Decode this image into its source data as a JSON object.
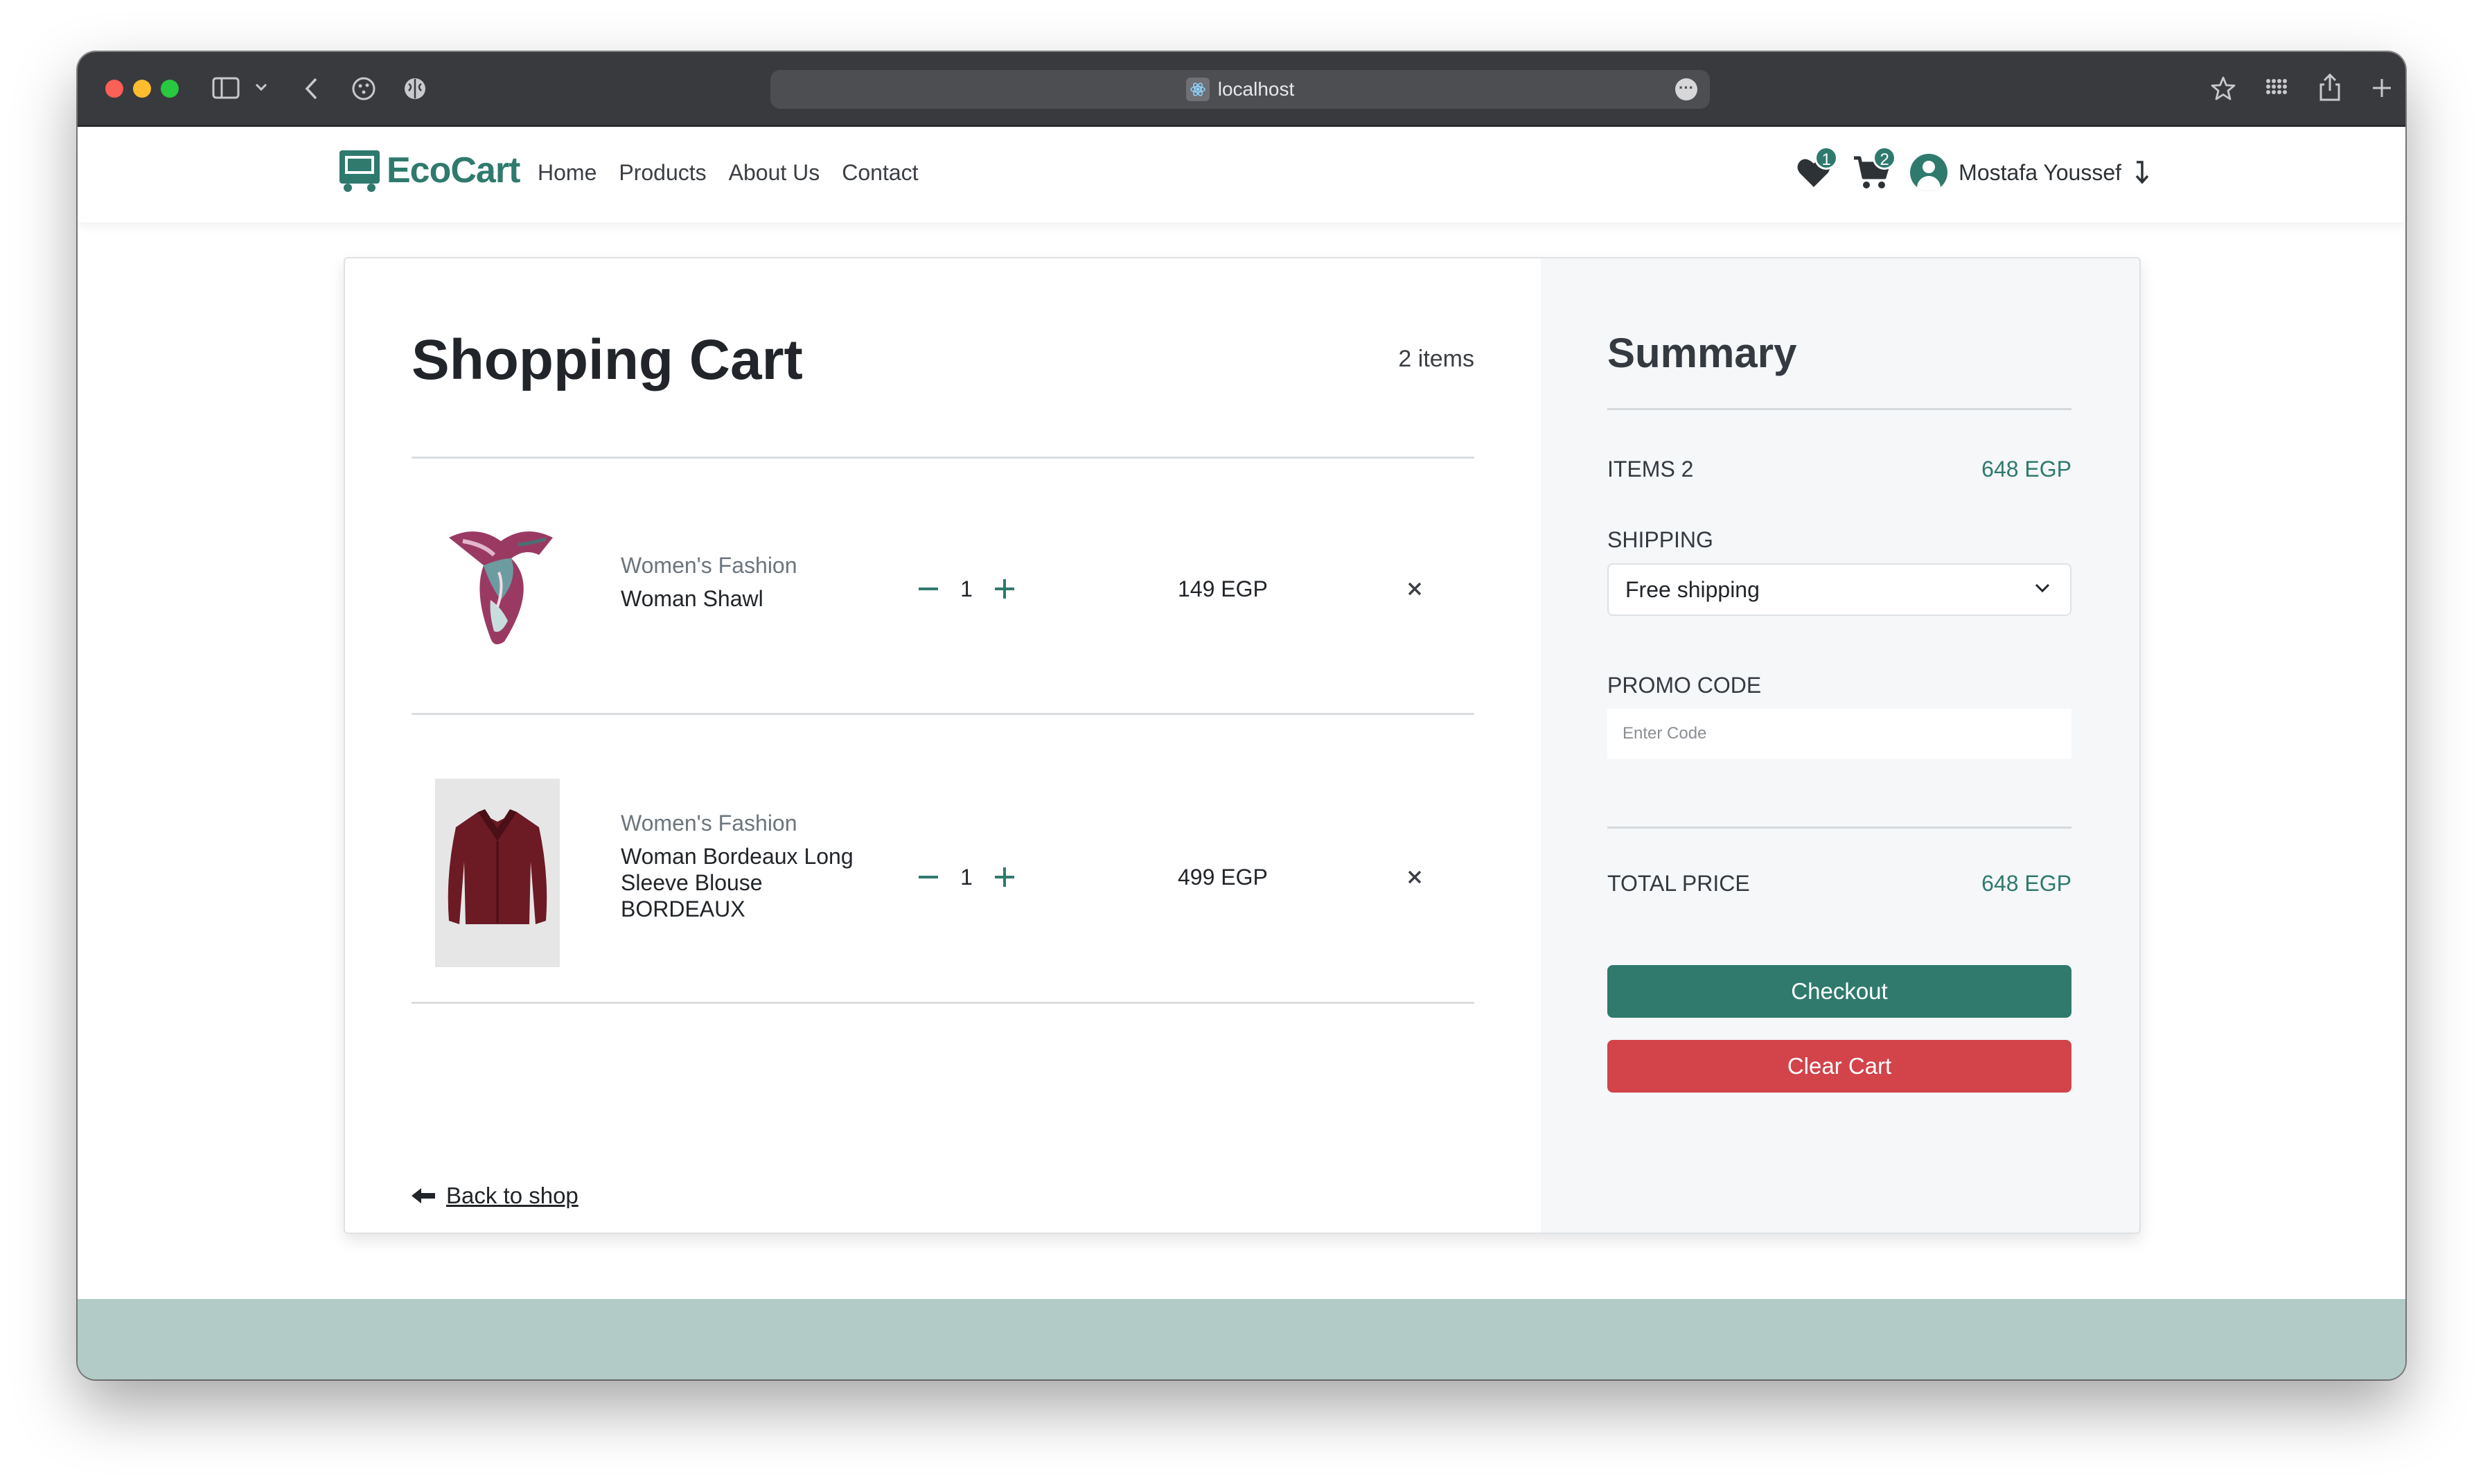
{
  "browser": {
    "url": "localhost"
  },
  "navbar": {
    "brand": "EcoCart",
    "links": [
      "Home",
      "Products",
      "About Us",
      "Contact"
    ],
    "wishlist_count": "1",
    "cart_count": "2",
    "user_name": "Mostafa Youssef"
  },
  "cart": {
    "title": "Shopping Cart",
    "count_label": "2 items",
    "items": [
      {
        "category": "Women's Fashion",
        "name": "Woman Shawl",
        "quantity": "1",
        "price": "149 EGP"
      },
      {
        "category": "Women's Fashion",
        "name": "Woman Bordeaux Long Sleeve Blouse BORDEAUX",
        "quantity": "1",
        "price": "499 EGP"
      }
    ],
    "back_link": "Back to shop"
  },
  "summary": {
    "title": "Summary",
    "items_label": "ITEMS 2",
    "items_value": "648 EGP",
    "shipping_label": "SHIPPING",
    "shipping_selected": "Free shipping",
    "promo_label": "PROMO CODE",
    "promo_placeholder": "Enter Code",
    "total_label": "TOTAL PRICE",
    "total_value": "648 EGP",
    "checkout_label": "Checkout",
    "clear_label": "Clear Cart"
  },
  "colors": {
    "brand": "#2f7a6d",
    "danger": "#d2434a",
    "footer": "#b2cbc6"
  }
}
